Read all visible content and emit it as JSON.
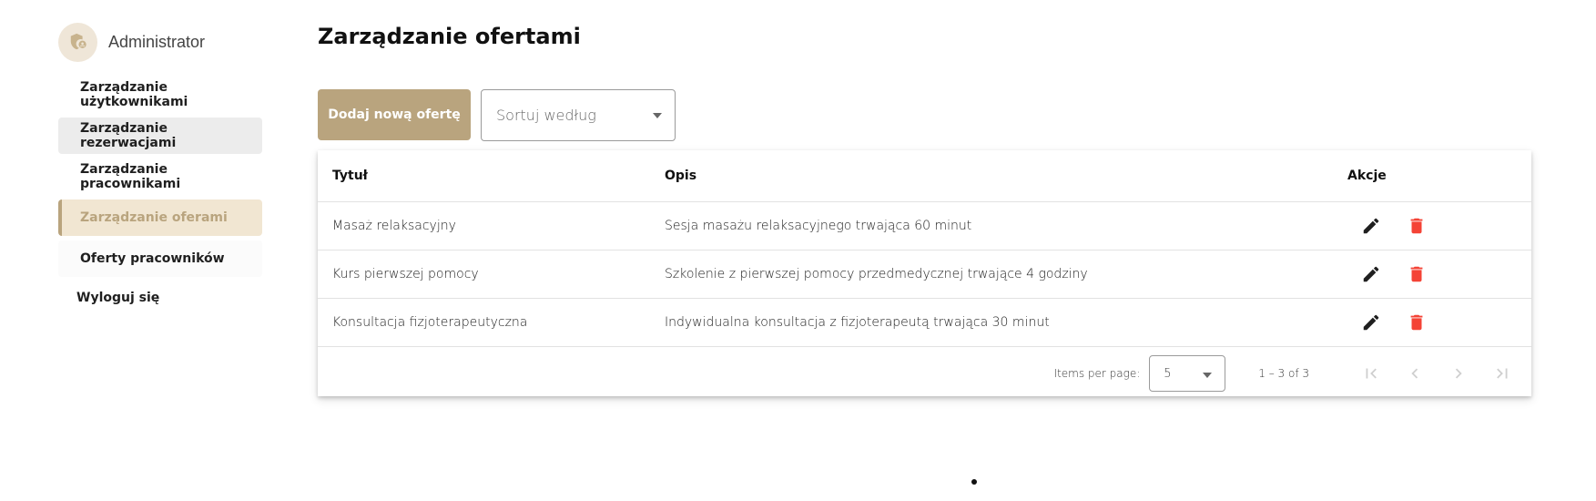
{
  "sidebar": {
    "profile_name": "Administrator",
    "items": [
      {
        "label": "Zarządzanie użytkownikami"
      },
      {
        "label": "Zarządzanie rezerwacjami"
      },
      {
        "label": "Zarządzanie pracownikami"
      },
      {
        "label": "Zarządzanie oferami"
      },
      {
        "label": "Oferty pracowników"
      }
    ],
    "logout_label": "Wyloguj się"
  },
  "main": {
    "title": "Zarządzanie ofertami",
    "add_button": "Dodaj nową ofertę",
    "sort_placeholder": "Sortuj według"
  },
  "table": {
    "headers": {
      "title": "Tytuł",
      "description": "Opis",
      "actions": "Akcje"
    },
    "rows": [
      {
        "title": "Masaż relaksacyjny",
        "description": "Sesja masażu relaksacyjnego trwająca 60 minut"
      },
      {
        "title": "Kurs pierwszej pomocy",
        "description": "Szkolenie z pierwszej pomocy przedmedycznej trwające 4 godziny"
      },
      {
        "title": "Konsultacja fizjoterapeutyczna",
        "description": "Indywidualna konsultacja z fizjoterapeutą trwająca 30 minut"
      }
    ]
  },
  "paginator": {
    "items_per_page_label": "Items per page:",
    "items_per_page_value": "5",
    "range_label": "1 – 3 of 3"
  },
  "colors": {
    "accent": "#b9a47e",
    "delete": "#f44336",
    "active_bg": "#f1e6d2"
  },
  "icons": [
    "user-shield-icon",
    "edit-icon",
    "delete-icon",
    "first-page-icon",
    "prev-page-icon",
    "next-page-icon",
    "last-page-icon"
  ]
}
